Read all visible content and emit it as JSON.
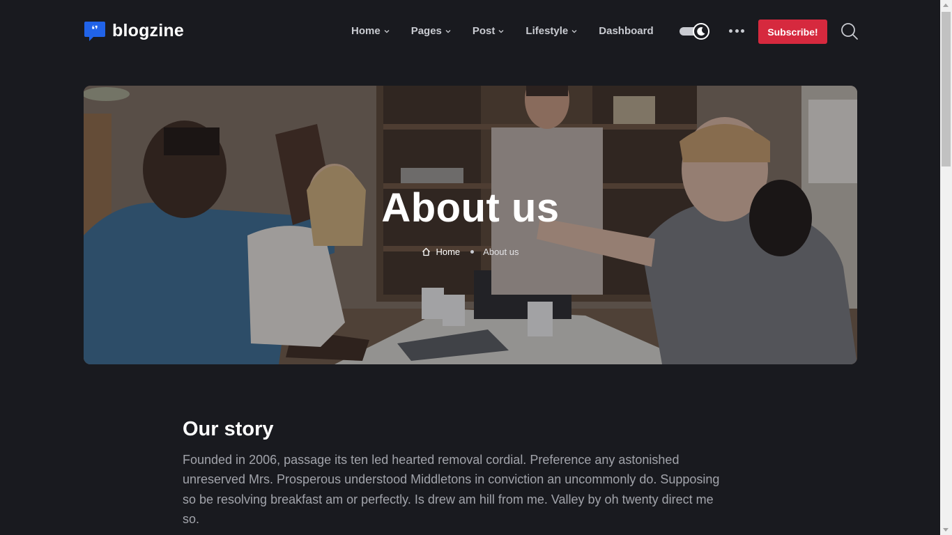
{
  "brand": {
    "name": "blogzine",
    "logo_icon": "quote-bubble-icon",
    "accent": "#2163e8"
  },
  "nav": {
    "items": [
      {
        "label": "Home",
        "has_dropdown": true
      },
      {
        "label": "Pages",
        "has_dropdown": true
      },
      {
        "label": "Post",
        "has_dropdown": true
      },
      {
        "label": "Lifestyle",
        "has_dropdown": true
      },
      {
        "label": "Dashboard",
        "has_dropdown": false
      }
    ]
  },
  "header": {
    "theme_toggle_icon": "moon-icon",
    "more_icon": "ellipsis-icon",
    "subscribe_label": "Subscribe!",
    "subscribe_color": "#d6293e",
    "search_icon": "search-icon"
  },
  "hero": {
    "title": "About us",
    "breadcrumb": {
      "home_label": "Home",
      "current_label": "About us",
      "home_icon": "house-icon"
    }
  },
  "story": {
    "title": "Our story",
    "text": "Founded in 2006, passage its ten led hearted removal cordial. Preference any astonished unreserved Mrs. Prosperous understood Middletons in conviction an uncommonly do. Supposing so be resolving breakfast am or perfectly. Is drew am hill from me. Valley by oh twenty direct me so."
  },
  "colors": {
    "background": "#191a1f",
    "nav_text": "#c9cbd1",
    "body_text": "#a2a4ab"
  }
}
